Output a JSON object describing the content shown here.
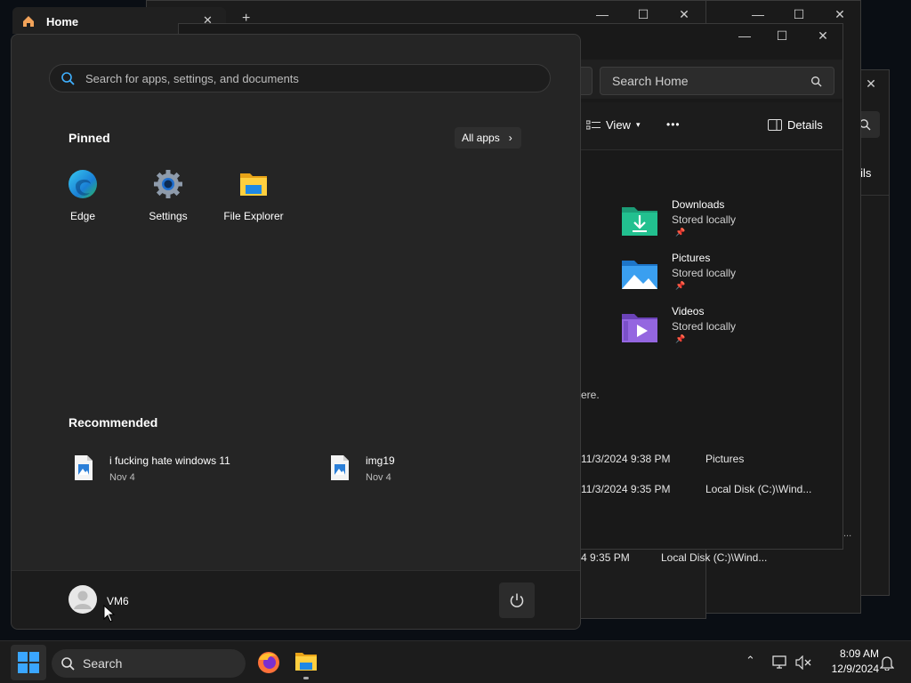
{
  "browser_tab": {
    "title": "Home",
    "close": "✕",
    "new_tab": "+"
  },
  "explorer": {
    "search_placeholder": "Search Home",
    "view_label": "View",
    "more_label": "•••",
    "details_label": "Details",
    "details_partial": "etails",
    "folders": [
      {
        "name": "Downloads",
        "status": "Stored locally",
        "color": "#20b486"
      },
      {
        "name": "Pictures",
        "status": "Stored locally",
        "color": "#2d8fe0"
      },
      {
        "name": "Videos",
        "status": "Stored locally",
        "color": "#8b5fd6"
      }
    ],
    "partial_text": "ere.",
    "recent_rows": [
      {
        "date": "11/3/2024 9:38 PM",
        "location": "Pictures"
      },
      {
        "date": "11/3/2024 9:35 PM",
        "location": "Local Disk (C:)\\Wind..."
      }
    ],
    "behind_row": {
      "date": "4 9:35 PM",
      "location": "Local Disk (C:)\\Wind..."
    },
    "behind_ellipsis": "..."
  },
  "start_menu": {
    "search_placeholder": "Search for apps, settings, and documents",
    "pinned_title": "Pinned",
    "all_apps_label": "All apps",
    "pinned": [
      {
        "label": "Edge",
        "icon": "edge-icon"
      },
      {
        "label": "Settings",
        "icon": "gear-icon"
      },
      {
        "label": "File Explorer",
        "icon": "folder-icon"
      }
    ],
    "recommended_title": "Recommended",
    "recommended": [
      {
        "name": "i fucking hate windows 11",
        "date": "Nov 4"
      },
      {
        "name": "img19",
        "date": "Nov 4"
      }
    ],
    "user_name": "VM6"
  },
  "taskbar": {
    "search_label": "Search",
    "time": "8:09 AM",
    "date": "12/9/2024"
  },
  "colors": {
    "accent": "#1a9bf0",
    "panel": "#252525",
    "taskbar": "#1c1c1c"
  }
}
